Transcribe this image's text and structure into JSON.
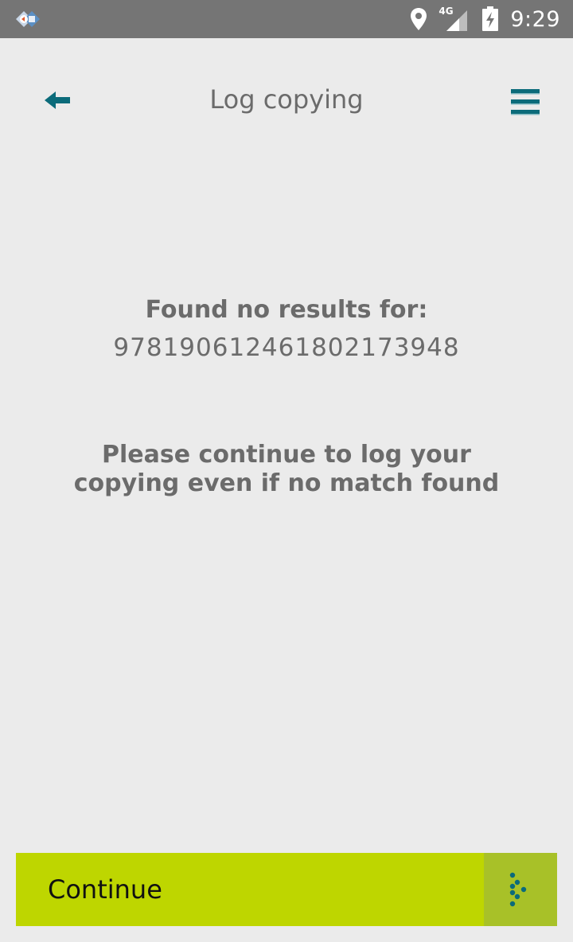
{
  "status_bar": {
    "time": "9:29",
    "network_type": "4G",
    "icons": [
      "app-logo-icon",
      "location-icon",
      "signal-icon",
      "battery-charging-icon"
    ]
  },
  "header": {
    "title": "Log copying",
    "back_icon": "arrow-left-icon",
    "menu_icon": "hamburger-menu-icon"
  },
  "results": {
    "found_label": "Found no results for:",
    "query": "9781906124618021739​48"
  },
  "instruction": "Please continue to log your copying even if no match found",
  "footer": {
    "continue_label": "Continue",
    "continue_icon": "dotted-arrow-icon"
  },
  "colors": {
    "accent_teal": "#0b6b7a",
    "continue_green": "#bed600",
    "continue_icon_bg": "#a8c128",
    "status_bar": "#757575",
    "background": "#ebebeb",
    "text_gray": "#6b6b6b"
  }
}
